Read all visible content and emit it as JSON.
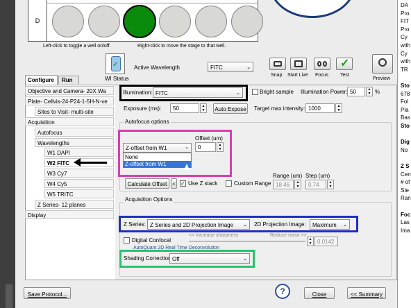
{
  "plate": {
    "row_label": "D",
    "wells_on": [
      false,
      false,
      true,
      false,
      false,
      false
    ],
    "hint_left": "Left-click to toggle a well on/off.",
    "hint_right": "Right-click to move the stage to that well."
  },
  "toolbar": {
    "wi_status": "WI Status",
    "active_wavelength_label": "Active Wavelength",
    "active_wavelength_value": "FITC",
    "snap": "Snap",
    "start_live": "Start Live",
    "focus": "Focus",
    "test": "Test",
    "preview": "Preview"
  },
  "tabs": [
    "Configure",
    "Run"
  ],
  "tree": [
    "Objective and Camera- 20X Wa",
    "Plate- Cellvis-24-P24-1-5H-N-ve",
    "Sites to Visit- multi-site",
    "Acquisition",
    "Autofocus",
    "Wavelengths",
    "W1 DAPI",
    "W2 FITC",
    "W3 Cy7",
    "W4 Cy5",
    "W5 TRITC",
    "Z Series- 12 planes",
    "Display"
  ],
  "illumination": {
    "label": "Illumination:",
    "value": "FITC",
    "bright_sample": "Bright sample",
    "power_label": "Illumination Power:",
    "power_value": "50",
    "power_unit": "%"
  },
  "exposure": {
    "label": "Exposure (ms):",
    "value": "50",
    "auto_expose": "Auto Expose",
    "target_label": "Target max intensity:",
    "target_value": "1000"
  },
  "autofocus": {
    "group_label": "Autofocus options",
    "offset_label": "Offset (um)",
    "selected": "Z-offset from W1",
    "offset_value": "0",
    "options": [
      "None",
      "Z-offset from W1"
    ],
    "calculate_offset": "Calculate Offset",
    "use_z_stack": "Use Z stack",
    "custom_range": "Custom Range",
    "range_label": "Range (um)",
    "range_value": "18.46",
    "step_label": "Step (um)",
    "step_value": "0.74"
  },
  "acquisition": {
    "group_label": "Acquisition Options",
    "z_series_label": "Z Series:",
    "z_series_value": "Z Series and 2D Projection Image",
    "projection_label": "2D Projection Image:",
    "projection_value": "Maximum",
    "digital_confocal": "Digital Confocal",
    "increase_sharpness": "<< Increase sharpness",
    "reduce_noise": "Reduce noise >>",
    "deconv_value": "0.0142",
    "deconv_text": "AutoQuant 2D Real Time Deconvolution",
    "shading_label": "Shading Correction",
    "shading_value": "Off"
  },
  "footer": {
    "save_protocol": "Save Protocol...",
    "help": "?",
    "close": "Close",
    "summary": "<< Summary"
  },
  "right_panel": {
    "lines": [
      "DA",
      "Pro",
      "FIT",
      "Pro",
      "Cy",
      "with",
      "Cy",
      "with",
      "TR",
      "",
      "Sto",
      "678",
      "Fol",
      "Pla",
      "Bas",
      "Sto",
      "",
      "Dig",
      "No",
      "",
      "Z S",
      "Cen",
      "# of",
      "Ste",
      "Ran",
      "",
      "Foc",
      "Las",
      "Ima"
    ]
  },
  "colors": {
    "illumination_box": "#000000",
    "autofocus_box": "#d63fb0",
    "zseries_box": "#1f2fc0",
    "shading_box": "#28c26e",
    "selection": "#3875d7",
    "well_on": "#0a8a0a"
  }
}
